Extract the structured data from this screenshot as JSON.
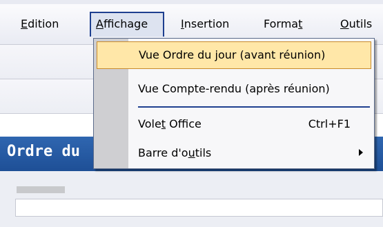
{
  "menubar": {
    "items": [
      {
        "label": "Edition",
        "mnemonic": "E"
      },
      {
        "label": "Affichage",
        "mnemonic": "A"
      },
      {
        "label": "Insertion",
        "mnemonic": "I"
      },
      {
        "label": "Format",
        "mnemonic": "t"
      },
      {
        "label": "Outils",
        "mnemonic": "O"
      }
    ]
  },
  "title_band": {
    "text": "Ordre du"
  },
  "dropdown": {
    "items": [
      {
        "label": "Vue Ordre du jour (avant réunion)",
        "highlighted": true
      },
      {
        "label": "Vue Compte-rendu (après réunion)"
      },
      {
        "label": "Volet Office",
        "shortcut": "Ctrl+F1"
      },
      {
        "label": "Barre d'outils",
        "submenu_icon": "chevron-right-icon"
      }
    ]
  },
  "colors": {
    "title_band": "#2a5fa8",
    "highlight_fill": "#ffe7a8",
    "highlight_border": "#c88a2a",
    "menu_active_border": "#1e3f8f"
  }
}
